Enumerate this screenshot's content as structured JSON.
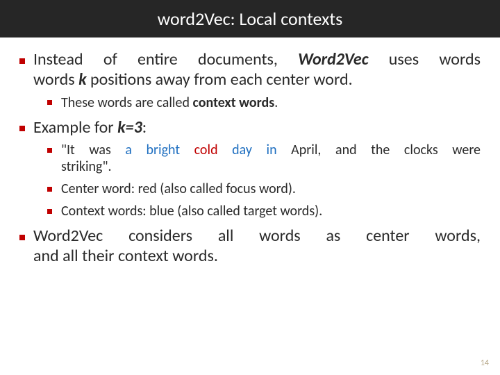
{
  "title": "word2Vec: Local contexts",
  "b1_a": "Instead of entire documents, ",
  "b1_b": "Word2Vec",
  "b1_c": " uses words ",
  "b1_d": "k",
  "b1_e": " positions away from each center word.",
  "b1_1_a": "These words are called ",
  "b1_1_b": "context words",
  "b1_1_c": ".",
  "b2_a": "Example for ",
  "b2_b": "k=3",
  "b2_c": ":",
  "b2_1_a": "\"It was ",
  "b2_1_b": "a bright ",
  "b2_1_c": "cold",
  "b2_1_d": " day in",
  "b2_1_e": " April, and the clocks were striking\".",
  "b2_2": "Center word: red (also called focus word).",
  "b2_3": "Context words: blue (also called target words).",
  "b3": "Word2Vec considers all words as center words, and all their context words.",
  "pagenum": "14"
}
